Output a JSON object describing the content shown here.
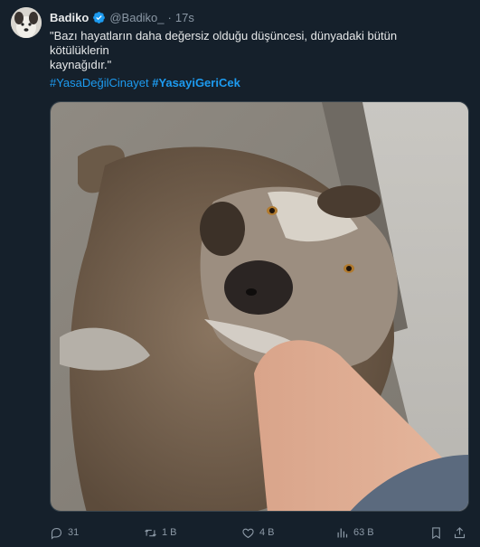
{
  "author": {
    "name": "Badiko",
    "handle": "@Badiko_",
    "separator": "·",
    "time": "17s"
  },
  "tweet": {
    "line1": "\"Bazı hayatların daha değersiz olduğu düşüncesi, dünyadaki bütün",
    "line2": "kötülüklerin",
    "line3": "kaynağıdır.\"",
    "hashtag1": "#YasaDeğilCinayet",
    "hashtag2": "#YasayiGeriCek"
  },
  "actions": {
    "replies": "31",
    "retweets": "1 B",
    "likes": "4 B",
    "views": "63 B"
  },
  "icons": [
    "verified-badge-icon",
    "reply-icon",
    "retweet-icon",
    "like-icon",
    "views-icon",
    "bookmark-icon",
    "share-icon"
  ],
  "colors": {
    "background": "#15202b",
    "accent": "#1d9bf0",
    "muted": "#8b98a5",
    "text": "#e7e9ea"
  }
}
